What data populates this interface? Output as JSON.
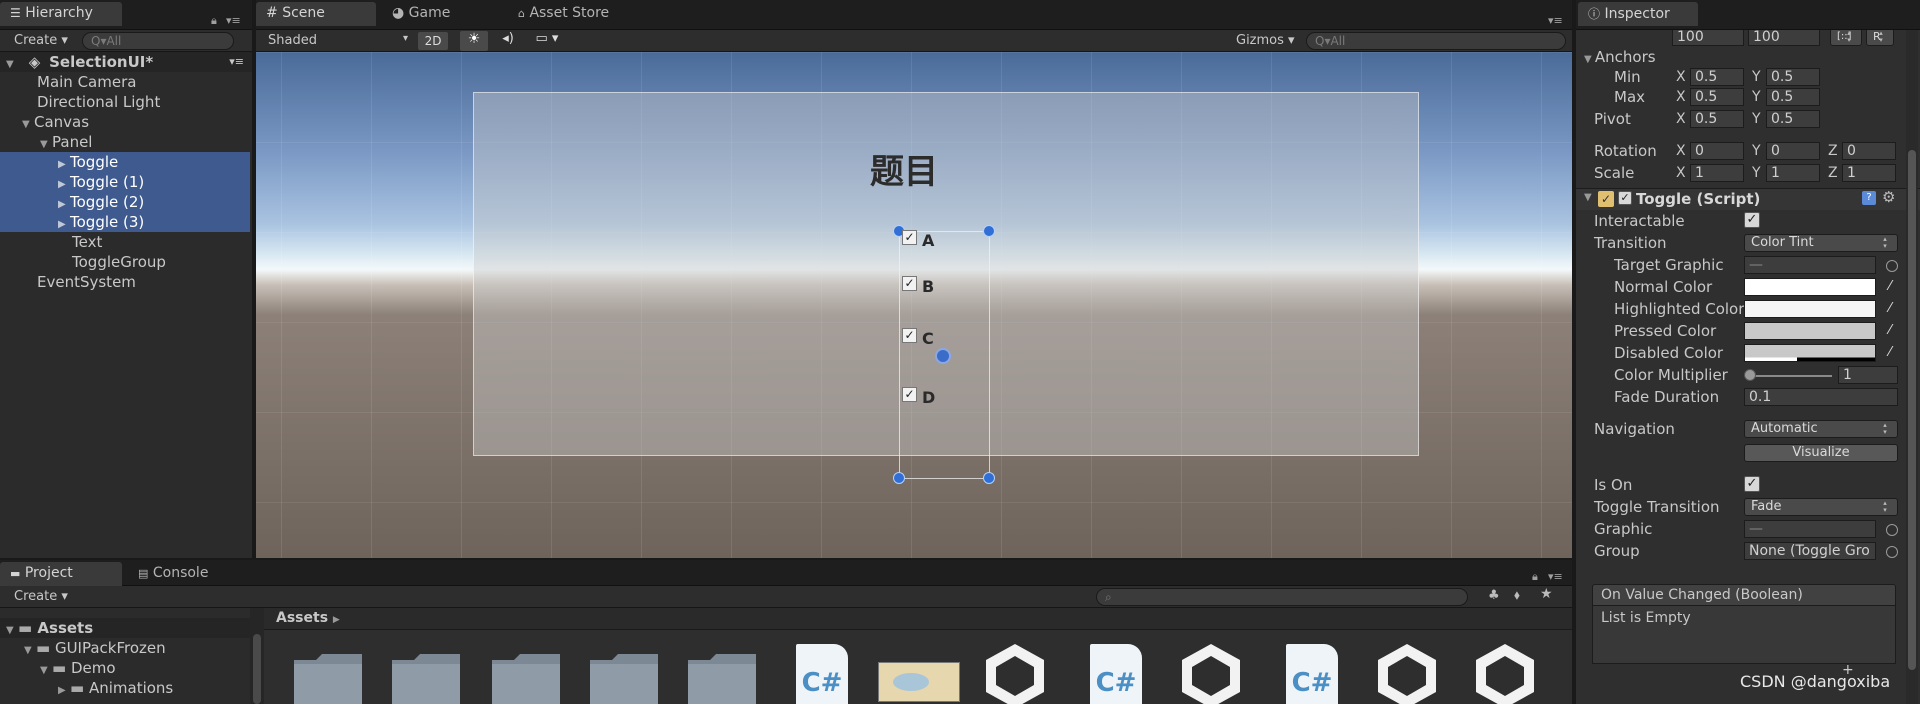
{
  "hierarchy": {
    "tab": "Hierarchy",
    "create_label": "Create",
    "search_placeholder": "Q▾All",
    "scene_name": "SelectionUI*",
    "items": [
      {
        "label": "Main Camera"
      },
      {
        "label": "Directional Light"
      },
      {
        "label": "Canvas"
      },
      {
        "label": "Panel"
      },
      {
        "label": "Toggle"
      },
      {
        "label": "Toggle (1)"
      },
      {
        "label": "Toggle (2)"
      },
      {
        "label": "Toggle (3)"
      },
      {
        "label": "Text"
      },
      {
        "label": "ToggleGroup"
      },
      {
        "label": "EventSystem"
      }
    ]
  },
  "scene": {
    "tabs": [
      {
        "label": "Scene",
        "icon": "grid-icon"
      },
      {
        "label": "Game",
        "icon": "pacman-icon"
      },
      {
        "label": "Asset Store",
        "icon": "bag-icon"
      }
    ],
    "shading_mode": "Shaded",
    "mode_2d": "2D",
    "gizmos_label": "Gizmos",
    "search_placeholder": "Q▾All",
    "panel_title": "题目",
    "toggle_labels": [
      "A",
      "B",
      "C",
      "D"
    ]
  },
  "inspector": {
    "tab": "Inspector",
    "top_values": [
      "100",
      "100"
    ],
    "top_buttons": [
      "[::]",
      "R"
    ],
    "anchors_label": "Anchors",
    "min_label": "Min",
    "max_label": "Max",
    "pivot_label": "Pivot",
    "rotation_label": "Rotation",
    "scale_label": "Scale",
    "anchor_min": {
      "x": "0.5",
      "y": "0.5"
    },
    "anchor_max": {
      "x": "0.5",
      "y": "0.5"
    },
    "pivot": {
      "x": "0.5",
      "y": "0.5"
    },
    "rotation": {
      "x": "0",
      "y": "0",
      "z": "0"
    },
    "scale": {
      "x": "1",
      "y": "1",
      "z": "1"
    },
    "axis_x": "X",
    "axis_y": "Y",
    "axis_z": "Z",
    "component_title": "Toggle (Script)",
    "interactable_label": "Interactable",
    "transition_label": "Transition",
    "transition_value": "Color Tint",
    "target_graphic_label": "Target Graphic",
    "target_graphic_value": "—",
    "normal_color_label": "Normal Color",
    "highlighted_color_label": "Highlighted Color",
    "pressed_color_label": "Pressed Color",
    "disabled_color_label": "Disabled Color",
    "color_multiplier_label": "Color Multiplier",
    "color_multiplier_value": "1",
    "fade_duration_label": "Fade Duration",
    "fade_duration_value": "0.1",
    "navigation_label": "Navigation",
    "navigation_value": "Automatic",
    "visualize_label": "Visualize",
    "is_on_label": "Is On",
    "toggle_transition_label": "Toggle Transition",
    "toggle_transition_value": "Fade",
    "graphic_label": "Graphic",
    "graphic_value": "—",
    "group_label": "Group",
    "group_value": "None (Toggle Gro",
    "event_title": "On Value Changed (Boolean)",
    "event_empty": "List is Empty",
    "colors": {
      "normal": "#ffffff",
      "highlighted": "#f5f5f5",
      "pressed": "#c8c8c8",
      "disabled": "#c8c8c8"
    }
  },
  "project": {
    "tabs": [
      {
        "label": "Project",
        "icon": "folder-icon"
      },
      {
        "label": "Console",
        "icon": "console-icon"
      }
    ],
    "create_label": "Create",
    "breadcrumb": "Assets",
    "tree": [
      {
        "label": "Assets"
      },
      {
        "label": "GUIPackFrozen"
      },
      {
        "label": "Demo"
      },
      {
        "label": "Animations"
      }
    ],
    "cs_label": "C#"
  },
  "watermark": "CSDN @dangoxiba"
}
